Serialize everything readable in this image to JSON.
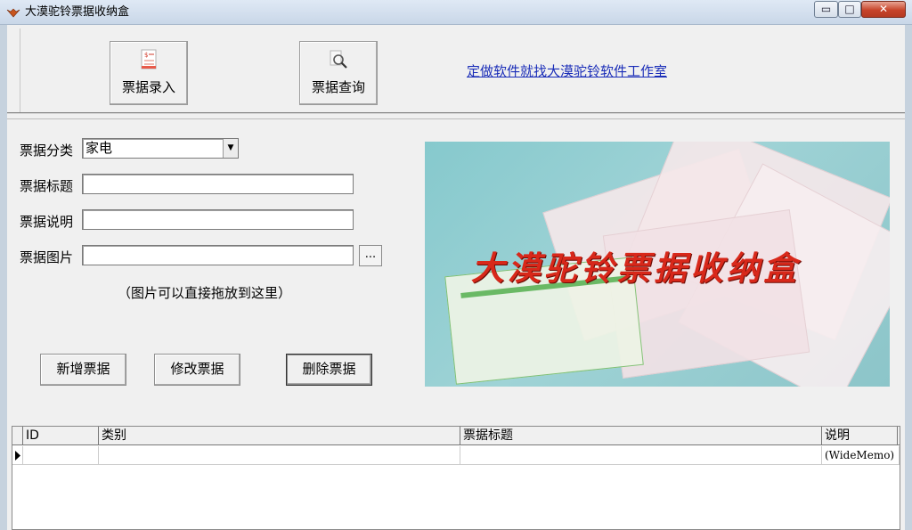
{
  "window": {
    "title": "大漠驼铃票据收纳盒",
    "minimize_glyph": "▭",
    "maximize_glyph": "□",
    "close_glyph": "✕"
  },
  "toolbar": {
    "entry_label": "票据录入",
    "query_label": "票据查询",
    "link_text": "定做软件就找大漠驼铃软件工作室"
  },
  "form": {
    "category_label": "票据分类",
    "category_value": "家电",
    "title_label": "票据标题",
    "title_value": "",
    "desc_label": "票据说明",
    "desc_value": "",
    "image_label": "票据图片",
    "image_value": "",
    "browse_label": "...",
    "hint": "（图片可以直接拖放到这里）",
    "add_label": "新增票据",
    "edit_label": "修改票据",
    "delete_label": "删除票据"
  },
  "banner": {
    "title": "大漠驼铃票据收纳盒"
  },
  "grid": {
    "columns": [
      "ID",
      "类别",
      "票据标题",
      "说明"
    ],
    "rows": [
      {
        "id": "",
        "category": "",
        "title": "",
        "memo": "(WideMemo)"
      }
    ]
  }
}
